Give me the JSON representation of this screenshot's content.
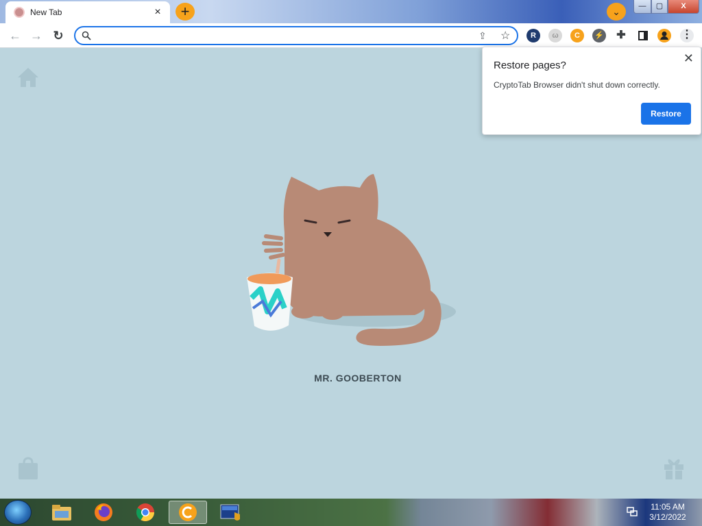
{
  "browser": {
    "tab": {
      "title": "New Tab",
      "close_label": "×"
    },
    "new_tab_label": "+",
    "tab_search_label": "⌄",
    "window_controls": {
      "minimize": "—",
      "maximize": "▢",
      "close": "X"
    },
    "toolbar": {
      "back_icon": "←",
      "forward_icon": "→",
      "reload_icon": "↻",
      "omnibox_value": "",
      "share_icon": "⇪",
      "bookmark_icon": "☆",
      "extensions": [
        {
          "name": "r-extension",
          "glyph": "R"
        },
        {
          "name": "gray-extension",
          "glyph": "ω"
        },
        {
          "name": "cryptotab-extension",
          "glyph": "C"
        },
        {
          "name": "bolt-extension",
          "glyph": "⚡"
        },
        {
          "name": "extensions-puzzle",
          "glyph": "✚"
        }
      ],
      "menu_icon": "⋮"
    }
  },
  "page": {
    "cat_name": "MR. GOOBERTON"
  },
  "popup": {
    "title": "Restore pages?",
    "message": "CryptoTab Browser didn't shut down correctly.",
    "restore_label": "Restore",
    "close_label": "✕"
  },
  "taskbar": {
    "clock_time": "11:05 AM",
    "clock_date": "3/12/2022"
  },
  "colors": {
    "page_bg": "#bcd5de",
    "accent_blue": "#1a73e8",
    "cryptotab_orange": "#f7a21b",
    "cat_brown": "#b88a76"
  }
}
